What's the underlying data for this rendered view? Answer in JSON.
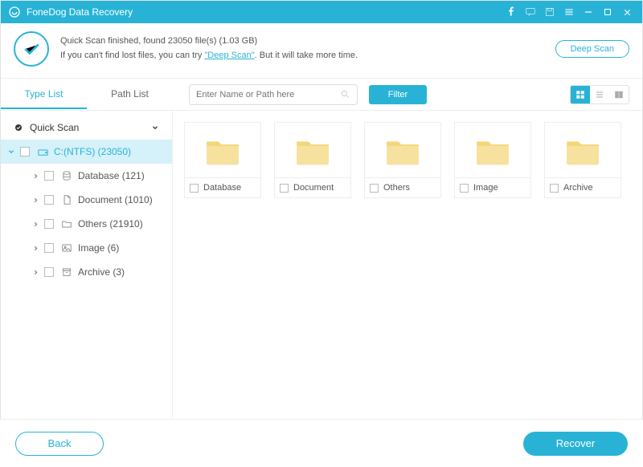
{
  "title": "FoneDog Data Recovery",
  "banner": {
    "line1_prefix": "Quick Scan finished, found ",
    "file_count": "23050",
    "line1_mid": " file(s) (",
    "total_size": "1.03 GB",
    "line1_suffix": ")",
    "line2_prefix": "If you can't find lost files, you can try ",
    "deep_link": "\"Deep Scan\"",
    "line2_suffix": ". But it will take more time.",
    "deep_button": "Deep Scan"
  },
  "tabs": {
    "type": "Type List",
    "path": "Path List"
  },
  "search": {
    "placeholder": "Enter Name or Path here"
  },
  "filter_label": "Filter",
  "tree": {
    "root": "Quick Scan",
    "drive": "C:(NTFS) (23050)",
    "children": [
      {
        "label": "Database (121)"
      },
      {
        "label": "Document (1010)"
      },
      {
        "label": "Others (21910)"
      },
      {
        "label": "Image (6)"
      },
      {
        "label": "Archive (3)"
      }
    ]
  },
  "folders": [
    {
      "label": "Database"
    },
    {
      "label": "Document"
    },
    {
      "label": "Others"
    },
    {
      "label": "Image"
    },
    {
      "label": "Archive"
    }
  ],
  "footer": {
    "back": "Back",
    "recover": "Recover"
  }
}
